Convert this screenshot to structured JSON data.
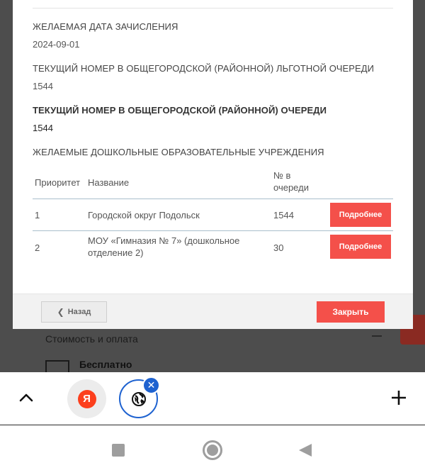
{
  "background": {
    "section_title": "Стоимость и оплата",
    "price_label": "Бесплатно"
  },
  "modal": {
    "desired_date_label": "ЖЕЛАЕМАЯ ДАТА ЗАЧИСЛЕНИЯ",
    "desired_date_value": "2024-09-01",
    "benefit_queue_label": "ТЕКУЩИЙ НОМЕР В ОБЩЕГОРОДСКОЙ (РАЙОННОЙ) ЛЬГОТНОЙ ОЧЕРЕДИ",
    "benefit_queue_value": "1544",
    "queue_label": "ТЕКУЩИЙ НОМЕР В ОБЩЕГОРОДСКОЙ (РАЙОННОЙ) ОЧЕРЕДИ",
    "queue_value": "1544",
    "institutions_label": "ЖЕЛАЕМЫЕ ДОШКОЛЬНЫЕ ОБРАЗОВАТЕЛЬНЫЕ УЧРЕЖДЕНИЯ",
    "table": {
      "headers": [
        "Приоритет",
        "Название",
        "№ в очереди"
      ],
      "rows": [
        {
          "priority": "1",
          "name": "Городской округ Подольск",
          "queue": "1544",
          "action": "Подробнее"
        },
        {
          "priority": "2",
          "name": "МОУ «Гимназия № 7» (дошкольное отделение 2)",
          "queue": "30",
          "action": "Подробнее"
        }
      ]
    },
    "back_label": "Назад",
    "close_label": "Закрыть"
  },
  "browser": {
    "tab1_logo": "Я",
    "tab_close_glyph": "✕",
    "icons": [
      "chevron-up-icon",
      "yandex-icon",
      "globe-icon",
      "close-icon",
      "plus-icon"
    ]
  },
  "nav": {
    "icons": [
      "recents-square-icon",
      "home-circle-icon",
      "back-triangle-icon"
    ]
  },
  "colors": {
    "accent": "#f4504a",
    "tab_blue": "#1e62d0",
    "table_line": "#a9bfcc"
  }
}
